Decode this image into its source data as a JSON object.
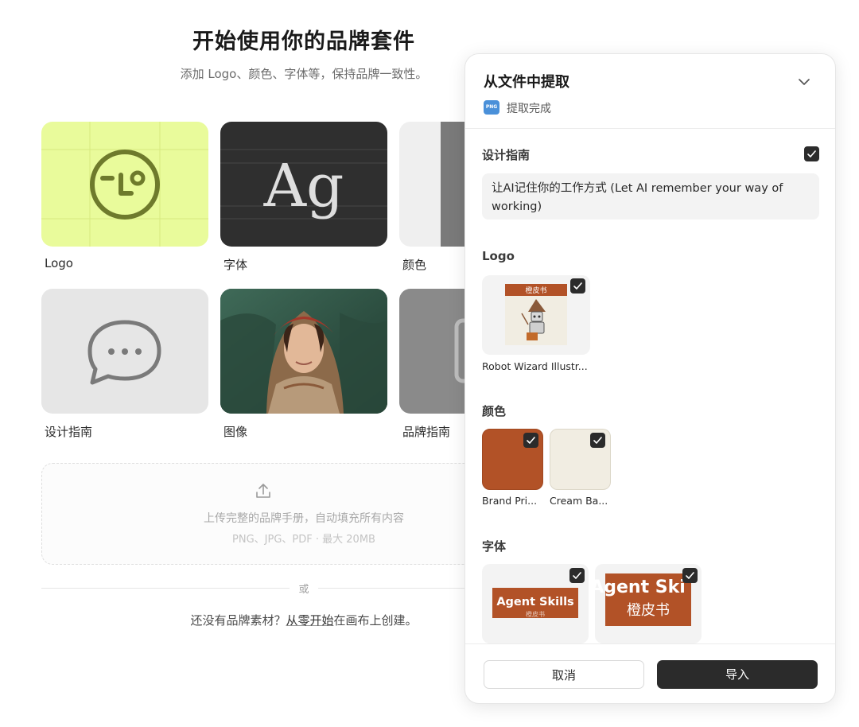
{
  "page": {
    "title": "开始使用你的品牌套件",
    "subtitle": "添加 Logo、颜色、字体等，保持品牌一致性。"
  },
  "tiles": [
    {
      "label": "Logo",
      "icon": "logo-mark-icon"
    },
    {
      "label": "字体",
      "icon": "typography-icon",
      "glyph": "Ag"
    },
    {
      "label": "颜色",
      "icon": "color-swatch-icon"
    },
    {
      "label": "设计指南",
      "icon": "speech-bubble-icon"
    },
    {
      "label": "图像",
      "icon": "portrait-image"
    },
    {
      "label": "品牌指南",
      "icon": "brand-guide-icon"
    }
  ],
  "upload": {
    "icon": "upload-icon",
    "text": "上传完整的品牌手册，自动填充所有内容",
    "hint": "PNG、JPG、PDF · 最大 20MB"
  },
  "divider": {
    "text": "或"
  },
  "footer": {
    "prefix": "还没有品牌素材？",
    "link": "从零开始",
    "suffix": "在画布上创建。"
  },
  "panel": {
    "title": "从文件中提取",
    "file_badge": "PNG",
    "status": "提取完成",
    "sections": {
      "guide": {
        "label": "设计指南",
        "checked": true,
        "text": "让AI记住你的工作方式 (Let AI remember your way of working)"
      },
      "logo": {
        "label": "Logo",
        "items": [
          {
            "name": "Robot Wizard Illustr...",
            "banner": "橙皮书",
            "checked": true
          }
        ]
      },
      "colors": {
        "label": "颜色",
        "items": [
          {
            "name": "Brand Pri...",
            "hex": "#b25227",
            "checked": true
          },
          {
            "name": "Cream Ba...",
            "hex": "#f1ede2",
            "checked": true
          }
        ]
      },
      "fonts": {
        "label": "字体",
        "items": [
          {
            "sample": "Agent Skills",
            "sub": "橙皮书",
            "checked": true
          },
          {
            "sample": "Agent Ski",
            "sub": "橙皮书",
            "checked": true
          }
        ]
      }
    },
    "buttons": {
      "cancel": "取消",
      "import": "导入"
    }
  },
  "colors": {
    "accent_dark": "#2b2b2b",
    "brand_orange": "#b25227",
    "cream": "#f1ede2",
    "logo_tile": "#e9fb9b"
  }
}
